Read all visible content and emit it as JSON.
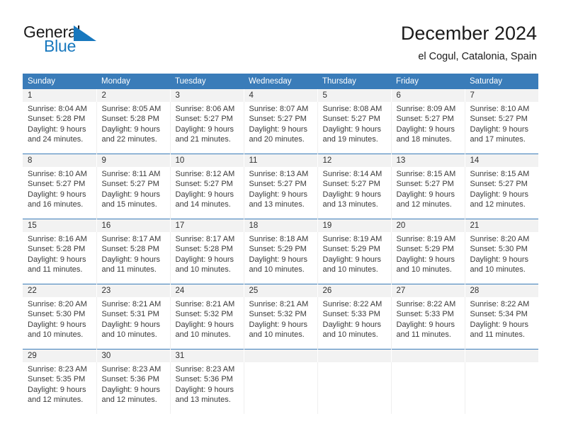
{
  "brand": {
    "word1": "General",
    "word2": "Blue",
    "mark": "triangle-logo",
    "color_dark": "#1b1b1b",
    "color_blue": "#1878be"
  },
  "header": {
    "title": "December 2024",
    "subtitle": "el Cogul, Catalonia, Spain"
  },
  "theme": {
    "header_bg": "#3a7cb9",
    "daynum_bg": "#f2f2f2",
    "text": "#3a3a3a"
  },
  "calendar": {
    "weekdays": [
      "Sunday",
      "Monday",
      "Tuesday",
      "Wednesday",
      "Thursday",
      "Friday",
      "Saturday"
    ],
    "weeks": [
      {
        "daynums": [
          "1",
          "2",
          "3",
          "4",
          "5",
          "6",
          "7"
        ],
        "cells": [
          {
            "sunrise": "Sunrise: 8:04 AM",
            "sunset": "Sunset: 5:28 PM",
            "daylight1": "Daylight: 9 hours",
            "daylight2": "and 24 minutes."
          },
          {
            "sunrise": "Sunrise: 8:05 AM",
            "sunset": "Sunset: 5:28 PM",
            "daylight1": "Daylight: 9 hours",
            "daylight2": "and 22 minutes."
          },
          {
            "sunrise": "Sunrise: 8:06 AM",
            "sunset": "Sunset: 5:27 PM",
            "daylight1": "Daylight: 9 hours",
            "daylight2": "and 21 minutes."
          },
          {
            "sunrise": "Sunrise: 8:07 AM",
            "sunset": "Sunset: 5:27 PM",
            "daylight1": "Daylight: 9 hours",
            "daylight2": "and 20 minutes."
          },
          {
            "sunrise": "Sunrise: 8:08 AM",
            "sunset": "Sunset: 5:27 PM",
            "daylight1": "Daylight: 9 hours",
            "daylight2": "and 19 minutes."
          },
          {
            "sunrise": "Sunrise: 8:09 AM",
            "sunset": "Sunset: 5:27 PM",
            "daylight1": "Daylight: 9 hours",
            "daylight2": "and 18 minutes."
          },
          {
            "sunrise": "Sunrise: 8:10 AM",
            "sunset": "Sunset: 5:27 PM",
            "daylight1": "Daylight: 9 hours",
            "daylight2": "and 17 minutes."
          }
        ]
      },
      {
        "daynums": [
          "8",
          "9",
          "10",
          "11",
          "12",
          "13",
          "14"
        ],
        "cells": [
          {
            "sunrise": "Sunrise: 8:10 AM",
            "sunset": "Sunset: 5:27 PM",
            "daylight1": "Daylight: 9 hours",
            "daylight2": "and 16 minutes."
          },
          {
            "sunrise": "Sunrise: 8:11 AM",
            "sunset": "Sunset: 5:27 PM",
            "daylight1": "Daylight: 9 hours",
            "daylight2": "and 15 minutes."
          },
          {
            "sunrise": "Sunrise: 8:12 AM",
            "sunset": "Sunset: 5:27 PM",
            "daylight1": "Daylight: 9 hours",
            "daylight2": "and 14 minutes."
          },
          {
            "sunrise": "Sunrise: 8:13 AM",
            "sunset": "Sunset: 5:27 PM",
            "daylight1": "Daylight: 9 hours",
            "daylight2": "and 13 minutes."
          },
          {
            "sunrise": "Sunrise: 8:14 AM",
            "sunset": "Sunset: 5:27 PM",
            "daylight1": "Daylight: 9 hours",
            "daylight2": "and 13 minutes."
          },
          {
            "sunrise": "Sunrise: 8:15 AM",
            "sunset": "Sunset: 5:27 PM",
            "daylight1": "Daylight: 9 hours",
            "daylight2": "and 12 minutes."
          },
          {
            "sunrise": "Sunrise: 8:15 AM",
            "sunset": "Sunset: 5:27 PM",
            "daylight1": "Daylight: 9 hours",
            "daylight2": "and 12 minutes."
          }
        ]
      },
      {
        "daynums": [
          "15",
          "16",
          "17",
          "18",
          "19",
          "20",
          "21"
        ],
        "cells": [
          {
            "sunrise": "Sunrise: 8:16 AM",
            "sunset": "Sunset: 5:28 PM",
            "daylight1": "Daylight: 9 hours",
            "daylight2": "and 11 minutes."
          },
          {
            "sunrise": "Sunrise: 8:17 AM",
            "sunset": "Sunset: 5:28 PM",
            "daylight1": "Daylight: 9 hours",
            "daylight2": "and 11 minutes."
          },
          {
            "sunrise": "Sunrise: 8:17 AM",
            "sunset": "Sunset: 5:28 PM",
            "daylight1": "Daylight: 9 hours",
            "daylight2": "and 10 minutes."
          },
          {
            "sunrise": "Sunrise: 8:18 AM",
            "sunset": "Sunset: 5:29 PM",
            "daylight1": "Daylight: 9 hours",
            "daylight2": "and 10 minutes."
          },
          {
            "sunrise": "Sunrise: 8:19 AM",
            "sunset": "Sunset: 5:29 PM",
            "daylight1": "Daylight: 9 hours",
            "daylight2": "and 10 minutes."
          },
          {
            "sunrise": "Sunrise: 8:19 AM",
            "sunset": "Sunset: 5:29 PM",
            "daylight1": "Daylight: 9 hours",
            "daylight2": "and 10 minutes."
          },
          {
            "sunrise": "Sunrise: 8:20 AM",
            "sunset": "Sunset: 5:30 PM",
            "daylight1": "Daylight: 9 hours",
            "daylight2": "and 10 minutes."
          }
        ]
      },
      {
        "daynums": [
          "22",
          "23",
          "24",
          "25",
          "26",
          "27",
          "28"
        ],
        "cells": [
          {
            "sunrise": "Sunrise: 8:20 AM",
            "sunset": "Sunset: 5:30 PM",
            "daylight1": "Daylight: 9 hours",
            "daylight2": "and 10 minutes."
          },
          {
            "sunrise": "Sunrise: 8:21 AM",
            "sunset": "Sunset: 5:31 PM",
            "daylight1": "Daylight: 9 hours",
            "daylight2": "and 10 minutes."
          },
          {
            "sunrise": "Sunrise: 8:21 AM",
            "sunset": "Sunset: 5:32 PM",
            "daylight1": "Daylight: 9 hours",
            "daylight2": "and 10 minutes."
          },
          {
            "sunrise": "Sunrise: 8:21 AM",
            "sunset": "Sunset: 5:32 PM",
            "daylight1": "Daylight: 9 hours",
            "daylight2": "and 10 minutes."
          },
          {
            "sunrise": "Sunrise: 8:22 AM",
            "sunset": "Sunset: 5:33 PM",
            "daylight1": "Daylight: 9 hours",
            "daylight2": "and 10 minutes."
          },
          {
            "sunrise": "Sunrise: 8:22 AM",
            "sunset": "Sunset: 5:33 PM",
            "daylight1": "Daylight: 9 hours",
            "daylight2": "and 11 minutes."
          },
          {
            "sunrise": "Sunrise: 8:22 AM",
            "sunset": "Sunset: 5:34 PM",
            "daylight1": "Daylight: 9 hours",
            "daylight2": "and 11 minutes."
          }
        ]
      },
      {
        "daynums": [
          "29",
          "30",
          "31",
          "",
          "",
          "",
          ""
        ],
        "cells": [
          {
            "sunrise": "Sunrise: 8:23 AM",
            "sunset": "Sunset: 5:35 PM",
            "daylight1": "Daylight: 9 hours",
            "daylight2": "and 12 minutes."
          },
          {
            "sunrise": "Sunrise: 8:23 AM",
            "sunset": "Sunset: 5:36 PM",
            "daylight1": "Daylight: 9 hours",
            "daylight2": "and 12 minutes."
          },
          {
            "sunrise": "Sunrise: 8:23 AM",
            "sunset": "Sunset: 5:36 PM",
            "daylight1": "Daylight: 9 hours",
            "daylight2": "and 13 minutes."
          },
          {
            "sunrise": "",
            "sunset": "",
            "daylight1": "",
            "daylight2": ""
          },
          {
            "sunrise": "",
            "sunset": "",
            "daylight1": "",
            "daylight2": ""
          },
          {
            "sunrise": "",
            "sunset": "",
            "daylight1": "",
            "daylight2": ""
          },
          {
            "sunrise": "",
            "sunset": "",
            "daylight1": "",
            "daylight2": ""
          }
        ]
      }
    ]
  }
}
